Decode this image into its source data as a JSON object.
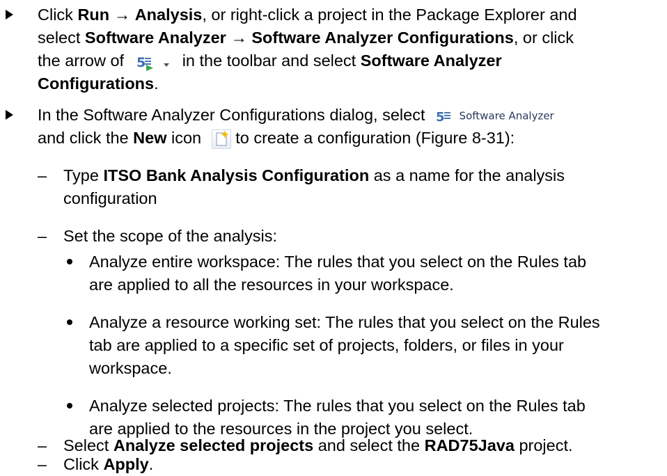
{
  "bullet1": {
    "line1_a": "Click ",
    "line1_run": "Run",
    "line1_arrow": " → ",
    "line1_analysis": "Analysis",
    "line1_b": ", or right-click a project in the Package Explorer and",
    "line2_a": "select ",
    "line2_sa": "Software Analyzer",
    "line2_arrow": " → ",
    "line2_sac": "Software Analyzer Configurations",
    "line2_b": ", or click",
    "line3_a": "the arrow of",
    "line3_b": "in the toolbar and select ",
    "line3_sac": "Software Analyzer",
    "line4_bold": "Configurations",
    "line4_end": "."
  },
  "bullet2": {
    "line1_a": "In the Software Analyzer Configurations dialog, select",
    "ui_label": "Software Analyzer",
    "line2_a": "and click the ",
    "line2_new": "New",
    "line2_b": " icon",
    "line2_c": " to create a configuration (Figure 8-31):"
  },
  "sub1": {
    "a": "Type ",
    "bold": "ITSO Bank Analysis Configuration",
    "b": " as a name for the analysis",
    "line2": "configuration"
  },
  "sub2": {
    "text": "Set the scope of the analysis:"
  },
  "dots": [
    {
      "l1": "Analyze entire workspace: The rules that you select on the Rules tab",
      "l2": "are applied to all the resources in your workspace."
    },
    {
      "l1": "Analyze a resource working set: The rules that you select on the Rules",
      "l2": "tab are applied to a specific set of projects, folders, or files in your",
      "l3": "workspace."
    },
    {
      "l1": "Analyze selected projects: The rules that you select on the Rules tab",
      "l2": "are applied to the resources in the project you select."
    }
  ],
  "sub3": {
    "a": "Select ",
    "bold1": "Analyze selected projects",
    "b": " and select the ",
    "bold2": "RAD75Java",
    "c": " project."
  },
  "sub4": {
    "a": "Click ",
    "bold": "Apply",
    "c": "."
  },
  "dash_char": "–",
  "icons": {
    "toolbar_icon": "software-analyzer-run-icon",
    "dropdown": "chevron-down-icon",
    "analyzer": "software-analyzer-icon",
    "new": "new-configuration-icon"
  }
}
